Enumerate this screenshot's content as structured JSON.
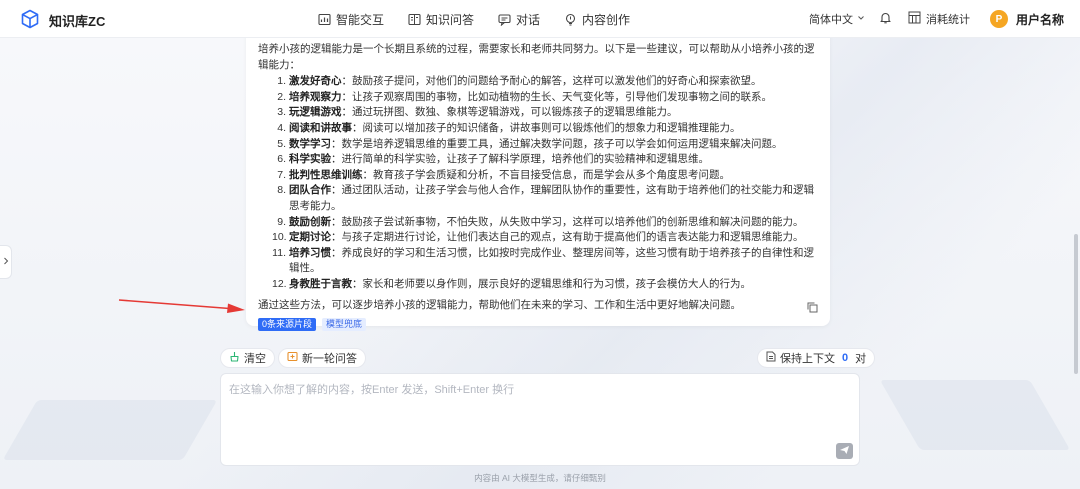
{
  "app": {
    "title": "知识库ZC"
  },
  "nav": [
    {
      "label": "智能交互",
      "icon": "chart-board-icon"
    },
    {
      "label": "知识问答",
      "icon": "book-icon"
    },
    {
      "label": "对话",
      "icon": "chat-icon"
    },
    {
      "label": "内容创作",
      "icon": "bulb-icon"
    }
  ],
  "header_right": {
    "language": "简体中文",
    "usage_label": "消耗统计",
    "avatar_letter": "P",
    "user_name": "用户名称"
  },
  "answer": {
    "intro": "培养小孩的逻辑能力是一个长期且系统的过程，需要家长和老师共同努力。以下是一些建议，可以帮助从小培养小孩的逻辑能力：",
    "items": [
      {
        "num": "1.",
        "title": "激发好奇心",
        "text": "：鼓励孩子提问，对他们的问题给予耐心的解答，这样可以激发他们的好奇心和探索欲望。"
      },
      {
        "num": "2.",
        "title": "培养观察力",
        "text": "：让孩子观察周围的事物，比如动植物的生长、天气变化等，引导他们发现事物之间的联系。"
      },
      {
        "num": "3.",
        "title": "玩逻辑游戏",
        "text": "：通过玩拼图、数独、象棋等逻辑游戏，可以锻炼孩子的逻辑思维能力。"
      },
      {
        "num": "4.",
        "title": "阅读和讲故事",
        "text": "：阅读可以增加孩子的知识储备，讲故事则可以锻炼他们的想象力和逻辑推理能力。"
      },
      {
        "num": "5.",
        "title": "数学学习",
        "text": "：数学是培养逻辑思维的重要工具，通过解决数学问题，孩子可以学会如何运用逻辑来解决问题。"
      },
      {
        "num": "6.",
        "title": "科学实验",
        "text": "：进行简单的科学实验，让孩子了解科学原理，培养他们的实验精神和逻辑思维。"
      },
      {
        "num": "7.",
        "title": "批判性思维训练",
        "text": "：教育孩子学会质疑和分析，不盲目接受信息，而是学会从多个角度思考问题。"
      },
      {
        "num": "8.",
        "title": "团队合作",
        "text": "：通过团队活动，让孩子学会与他人合作，理解团队协作的重要性，这有助于培养他们的社交能力和逻辑思考能力。"
      },
      {
        "num": "9.",
        "title": "鼓励创新",
        "text": "：鼓励孩子尝试新事物，不怕失败，从失败中学习，这样可以培养他们的创新思维和解决问题的能力。"
      },
      {
        "num": "10.",
        "title": "定期讨论",
        "text": "：与孩子定期进行讨论，让他们表达自己的观点，这有助于提高他们的语言表达能力和逻辑思维能力。"
      },
      {
        "num": "11.",
        "title": "培养习惯",
        "text": "：养成良好的学习和生活习惯，比如按时完成作业、整理房间等，这些习惯有助于培养孩子的自律性和逻辑性。"
      },
      {
        "num": "12.",
        "title": "身教胜于言教",
        "text": "：家长和老师要以身作则，展示良好的逻辑思维和行为习惯，孩子会模仿大人的行为。"
      }
    ],
    "summary": "通过这些方法，可以逐步培养小孩的逻辑能力，帮助他们在未来的学习、工作和生活中更好地解决问题。",
    "source_tag": "0条来源片段",
    "model_tag": "模型兜底"
  },
  "actions": {
    "clear_label": "清空",
    "new_round_label": "新一轮问答",
    "keep_context_label": "保持上下文",
    "context_count": "0",
    "context_unit": "对"
  },
  "input": {
    "placeholder": "在这输入你想了解的内容，按Enter 发送，Shift+Enter 换行"
  },
  "footer": {
    "disclaimer": "内容由 AI 大模型生成，请仔细甄别"
  },
  "colors": {
    "accent": "#2f6cf6",
    "avatar": "#f5a623",
    "arrow": "#e53935"
  }
}
